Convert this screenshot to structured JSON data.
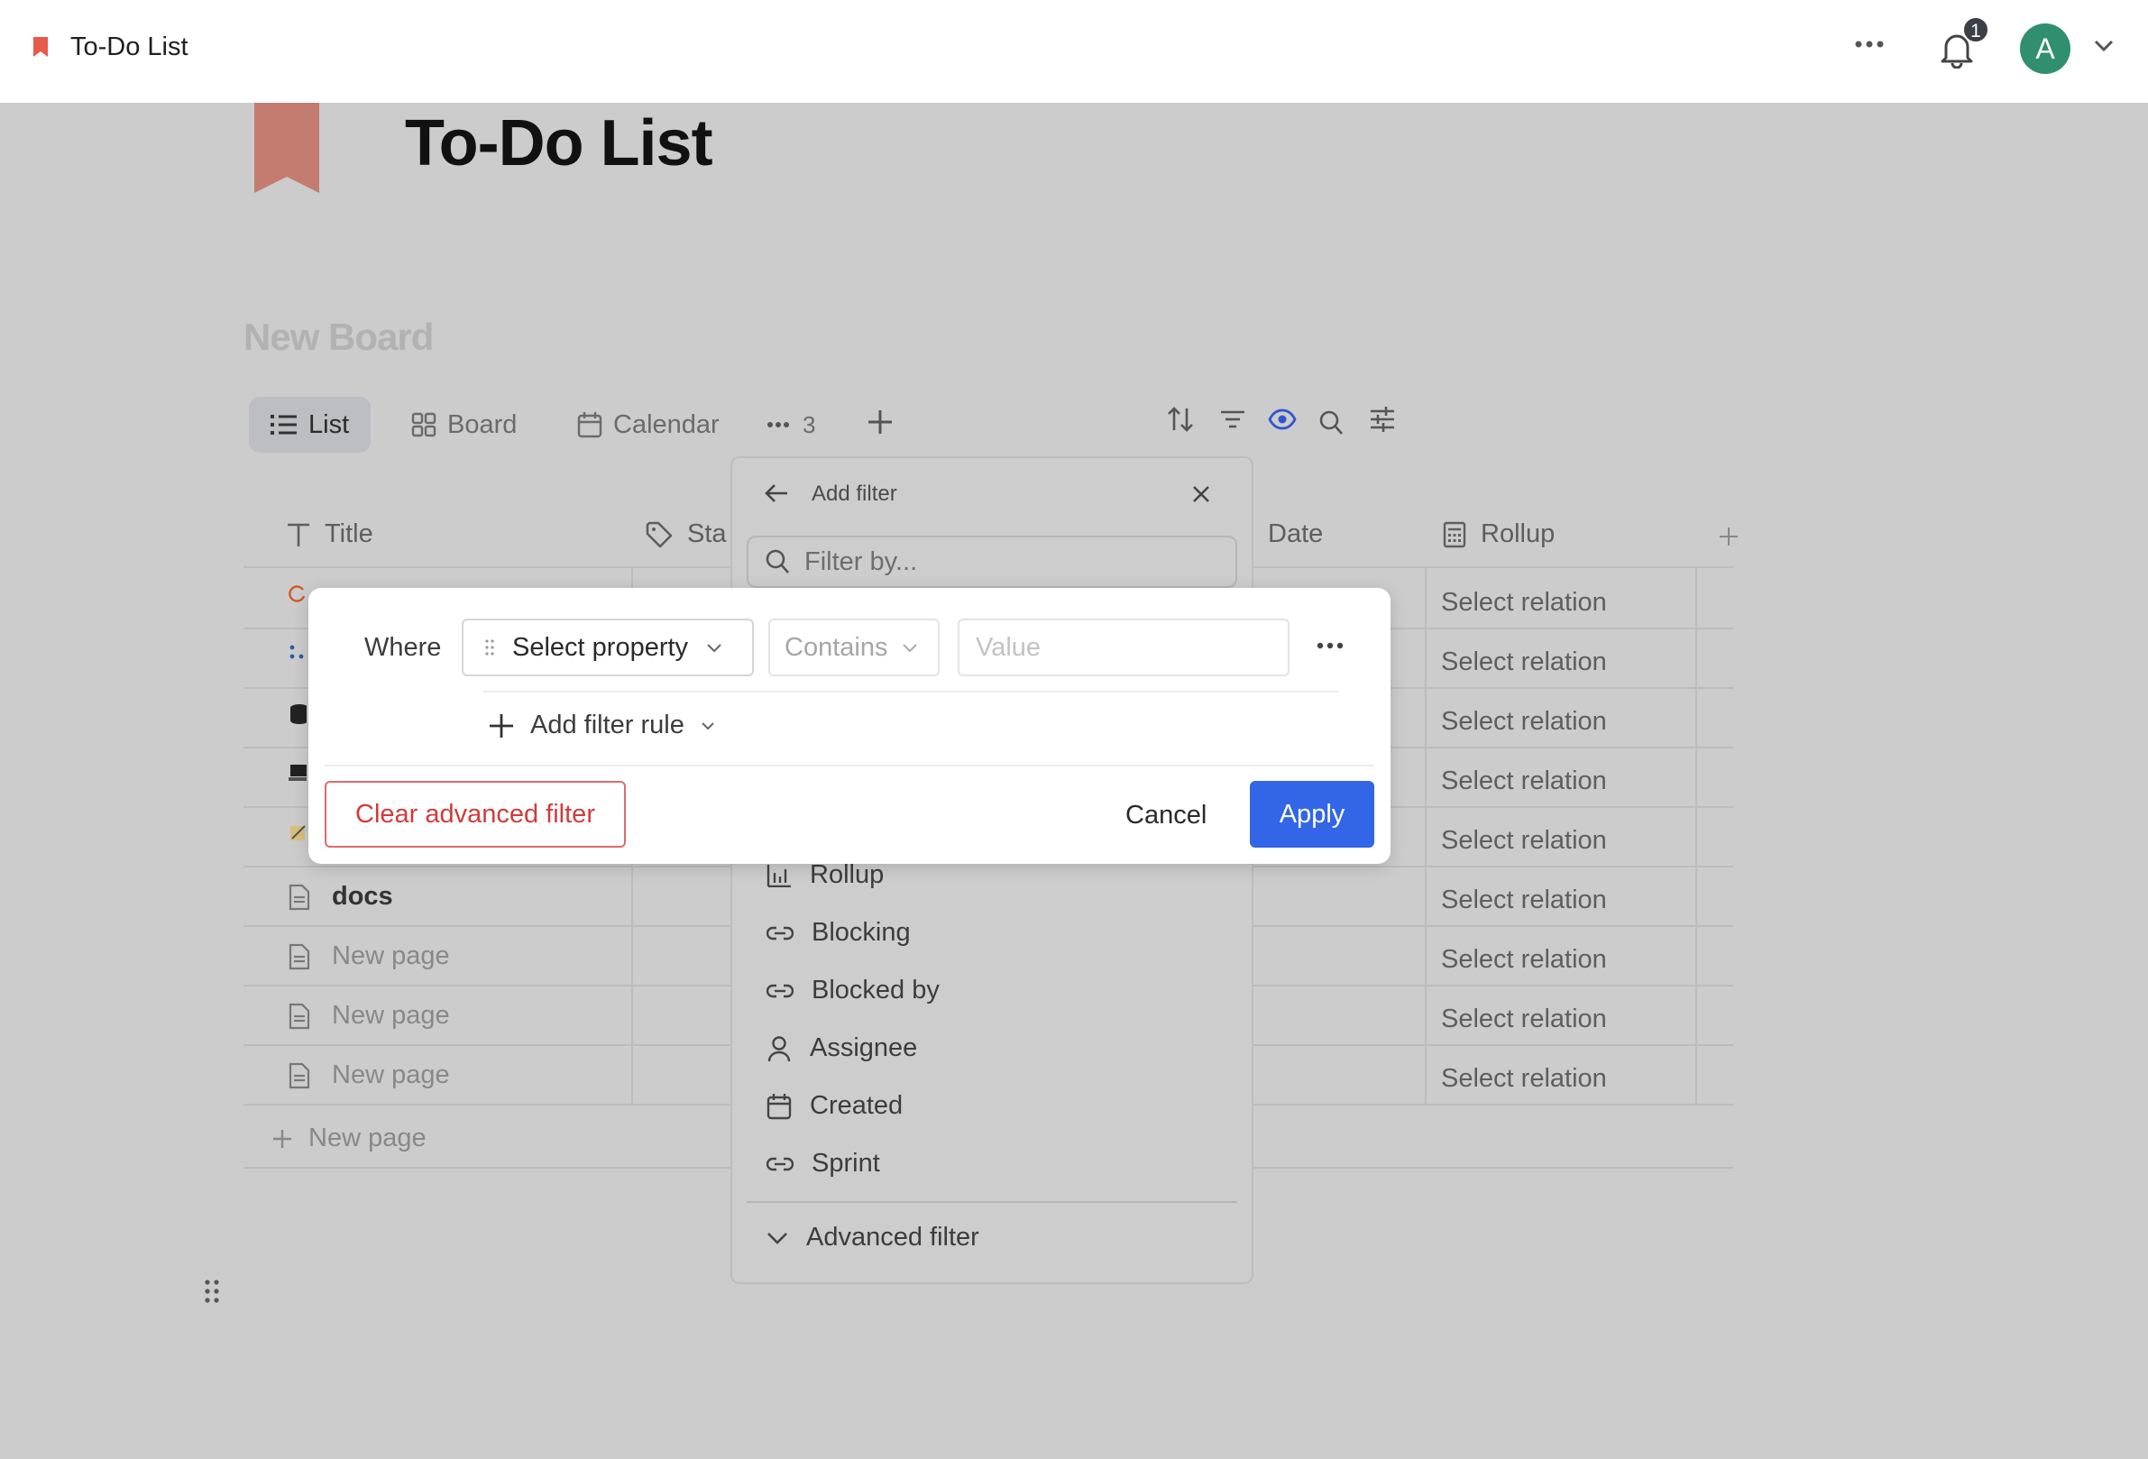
{
  "topbar": {
    "title": "To-Do List",
    "notification_count": "1",
    "avatar_initial": "A"
  },
  "page": {
    "title": "To-Do List",
    "board_title": "New Board"
  },
  "views": {
    "tabs": [
      {
        "label": "List",
        "active": true
      },
      {
        "label": "Board",
        "active": false
      },
      {
        "label": "Calendar",
        "active": false
      }
    ],
    "more_count": "3"
  },
  "table": {
    "columns": {
      "title": "Title",
      "status": "Sta",
      "date": "Date",
      "rollup": "Rollup"
    },
    "rows": [
      {
        "title": "",
        "rollup": "Select relation"
      },
      {
        "title": "",
        "rollup": "Select relation"
      },
      {
        "title": "",
        "rollup": "Select relation"
      },
      {
        "title": "",
        "rollup": "Select relation"
      },
      {
        "title": "",
        "rollup": "Select relation"
      },
      {
        "title": "docs",
        "rollup": "Select relation"
      },
      {
        "title": "New page",
        "rollup": "Select relation"
      },
      {
        "title": "New page",
        "rollup": "Select relation"
      },
      {
        "title": "New page",
        "rollup": "Select relation"
      }
    ],
    "new_page_label": "New page"
  },
  "filter_panel": {
    "header": "Add filter",
    "search_placeholder": "Filter by...",
    "items": [
      {
        "label": "Rollup",
        "icon": "rollup-icon"
      },
      {
        "label": "Blocking",
        "icon": "link-icon"
      },
      {
        "label": "Blocked by",
        "icon": "link-icon"
      },
      {
        "label": "Assignee",
        "icon": "person-icon"
      },
      {
        "label": "Created",
        "icon": "calendar-icon"
      },
      {
        "label": "Sprint",
        "icon": "link-icon"
      }
    ],
    "advanced_label": "Advanced filter"
  },
  "advanced_filter": {
    "where_label": "Where",
    "property_select": "Select property",
    "operator_select": "Contains",
    "value_placeholder": "Value",
    "add_rule_label": "Add filter rule",
    "clear_label": "Clear advanced filter",
    "cancel_label": "Cancel",
    "apply_label": "Apply"
  },
  "colors": {
    "accent": "#3366e6",
    "danger": "#d23b3b",
    "avatar": "#2f8f6f",
    "bookmark": "#e65a4a",
    "page_icon": "#c47b70"
  }
}
